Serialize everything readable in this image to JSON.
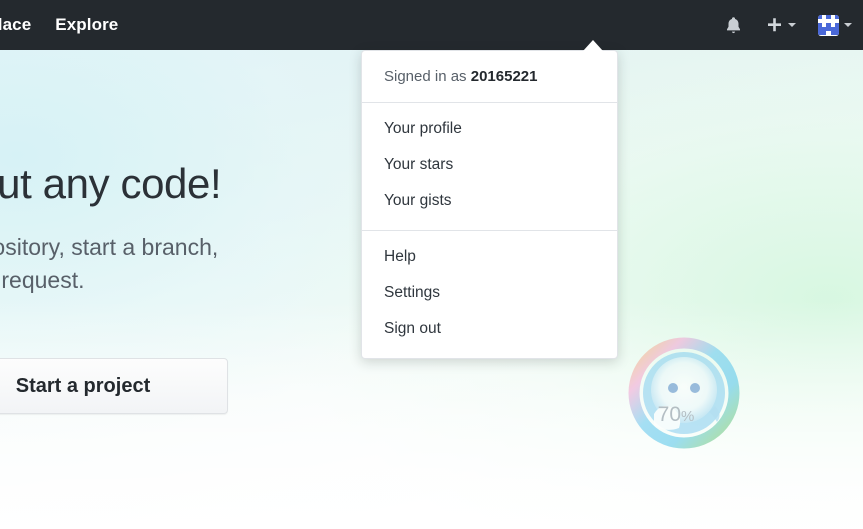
{
  "header": {
    "nav_links": [
      {
        "label": "etplace",
        "name": "nav-marketplace",
        "clipped": true
      },
      {
        "label": "Explore",
        "name": "nav-explore",
        "clipped": false
      }
    ],
    "icons": {
      "notifications": "bell-icon",
      "create_new": "plus-icon",
      "create_new_caret": "chevron-down-icon",
      "avatar": "avatar-identicon",
      "avatar_caret": "chevron-down-icon"
    },
    "background_color": "#24292e"
  },
  "dropdown": {
    "signed_in_prefix": "Signed in as",
    "username": "20165221",
    "groups": [
      {
        "items": [
          {
            "label": "Your profile",
            "name": "menu-item-your-profile"
          },
          {
            "label": "Your stars",
            "name": "menu-item-your-stars"
          },
          {
            "label": "Your gists",
            "name": "menu-item-your-gists"
          }
        ]
      },
      {
        "items": [
          {
            "label": "Help",
            "name": "menu-item-help"
          },
          {
            "label": "Settings",
            "name": "menu-item-settings"
          },
          {
            "label": "Sign out",
            "name": "menu-item-sign-out"
          }
        ]
      }
    ]
  },
  "hero": {
    "title": "thout any code!",
    "subtitle_line_1": "a repository, start a branch,",
    "subtitle_line_2": "a pull request.",
    "button_label": "Start a project"
  },
  "progress_widget": {
    "value": 70,
    "value_label": "70",
    "unit_label": "%",
    "ring_colors": [
      "#7ac943",
      "#4fc3e8",
      "#62c7ef",
      "#f2a2d2",
      "#f7b955"
    ],
    "text_color": "#7f8c99"
  },
  "colors": {
    "header_bg": "#24292e",
    "menu_bg": "#ffffff",
    "menu_border": "#e1e4e8",
    "text_primary": "#24292e",
    "text_muted": "#586069",
    "accent_blue": "#0366d6",
    "avatar_blue": "#4a68d8"
  }
}
